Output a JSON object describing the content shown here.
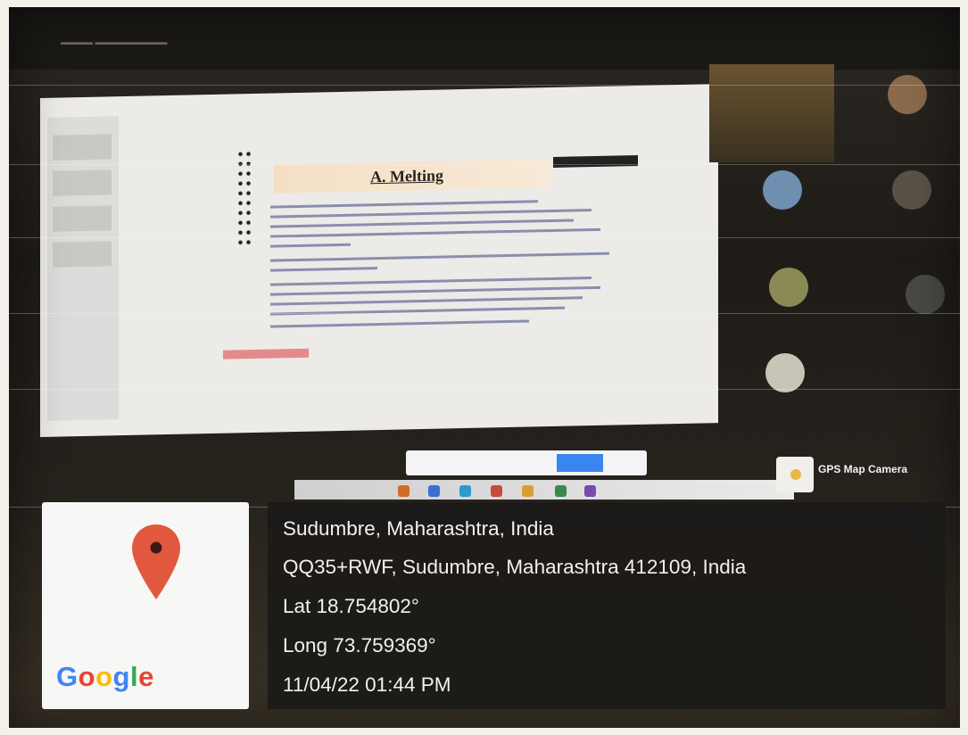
{
  "slide": {
    "title": "A. Melting"
  },
  "overlay": {
    "app_badge": "GPS Map Camera",
    "google_logo_letters": [
      "G",
      "o",
      "o",
      "g",
      "l",
      "e"
    ],
    "google_colors": [
      "#4285F4",
      "#EA4335",
      "#FBBC05",
      "#4285F4",
      "#34A853",
      "#EA4335"
    ],
    "pin_color": "#e2583e",
    "place": "Sudumbre, Maharashtra, India",
    "address": "QQ35+RWF, Sudumbre, Maharashtra 412109, India",
    "latitude": "Lat 18.754802°",
    "longitude": "Long 73.759369°",
    "datetime": "11/04/22 01:44 PM"
  },
  "icons": [
    "map-pin-icon",
    "google-logo",
    "gps-camera-icon"
  ]
}
